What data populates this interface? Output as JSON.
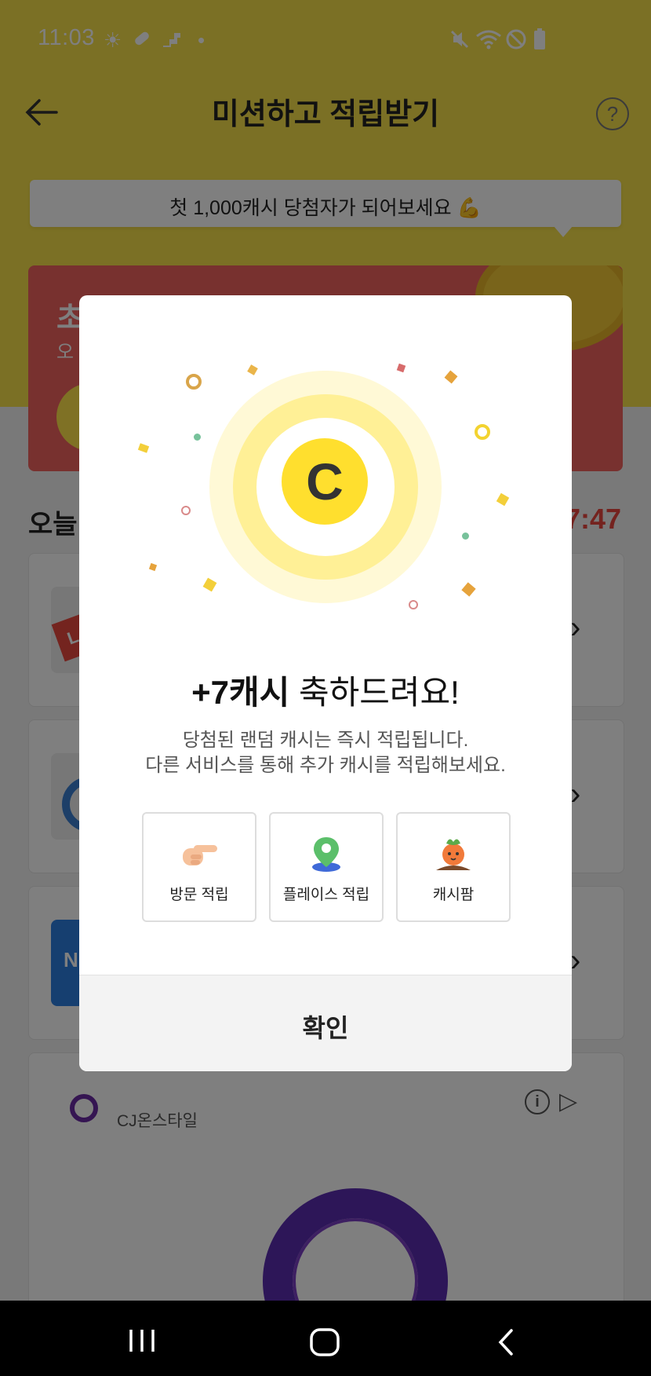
{
  "status_bar": {
    "time": "11:03"
  },
  "header": {
    "title": "미션하고 적립받기"
  },
  "tooltip": {
    "text": "첫 1,000캐시 당첨자가 되어보세요 💪"
  },
  "promo": {
    "title_partial": "초",
    "sub_partial": "오"
  },
  "today": {
    "label_partial": "오늘",
    "timer_partial": "7:47"
  },
  "list": [
    {
      "thumb_color": "#e8483f",
      "thumb_text": "L"
    },
    {
      "thumb_color": "#3b7fd1",
      "thumb_text": ""
    },
    {
      "thumb_color": "#2d7fe0",
      "thumb_text": "N"
    }
  ],
  "ad": {
    "brand": "CJ온스타일"
  },
  "dialog": {
    "title_bold": "+7캐시",
    "title_rest": " 축하드려요!",
    "desc_line1": "당첨된 랜덤 캐시는 즉시 적립됩니다.",
    "desc_line2": "다른 서비스를 통해 추가 캐시를 적립해보세요.",
    "coin_letter": "C",
    "services": [
      {
        "label": "방문 적립",
        "icon": "pointing-hand-icon"
      },
      {
        "label": "플레이스 적립",
        "icon": "map-pin-icon"
      },
      {
        "label": "캐시팜",
        "icon": "carrot-icon"
      }
    ],
    "confirm_label": "확인"
  },
  "colors": {
    "accent_yellow": "#f6e04a",
    "coin": "#ffdf2e",
    "timer_red": "#e8473f"
  }
}
